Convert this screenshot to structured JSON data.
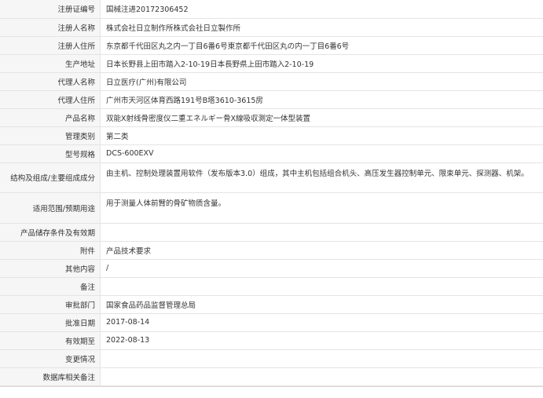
{
  "rows": [
    {
      "label": "注册证编号",
      "value": "国械注进20172306452"
    },
    {
      "label": "注册人名称",
      "value": "株式会社日立制作所株式会社日立製作所"
    },
    {
      "label": "注册人住所",
      "value": "东京都千代田区丸之内一丁目6番6号東京都千代田区丸の内一丁目6番6号"
    },
    {
      "label": "生产地址",
      "value": "日本长野县上田市踏入2-10-19日本長野県上田市踏入2-10-19"
    },
    {
      "label": "代理人名称",
      "value": "日立医疗(广州)有限公司"
    },
    {
      "label": "代理人住所",
      "value": "广州市天河区体育西路191号B塔3610-3615房"
    },
    {
      "label": "产品名称",
      "value": "双能X射线骨密度仪二重エネルギー骨X線吸収測定一体型装置"
    },
    {
      "label": "管理类别",
      "value": "第二类"
    },
    {
      "label": "型号规格",
      "value": "DCS-600EXV"
    },
    {
      "label": "结构及组成/主要组成成分",
      "value": "由主机、控制处理装置用软件（发布版本3.0）组成，其中主机包括组合机头、高压发生器控制单元、限束单元、探测器、机架。"
    },
    {
      "label": "适用范围/预期用途",
      "value": "用于测量人体前臂的骨矿物质含量。"
    },
    {
      "label": "产品储存条件及有效期",
      "value": ""
    },
    {
      "label": "附件",
      "value": "产品技术要求"
    },
    {
      "label": "其他内容",
      "value": "/"
    },
    {
      "label": "备注",
      "value": ""
    },
    {
      "label": "审批部门",
      "value": "国家食品药品监督管理总局"
    },
    {
      "label": "批准日期",
      "value": "2017-08-14"
    },
    {
      "label": "有效期至",
      "value": "2022-08-13"
    },
    {
      "label": "变更情况",
      "value": ""
    },
    {
      "label": "数据库相关备注",
      "value": ""
    }
  ]
}
